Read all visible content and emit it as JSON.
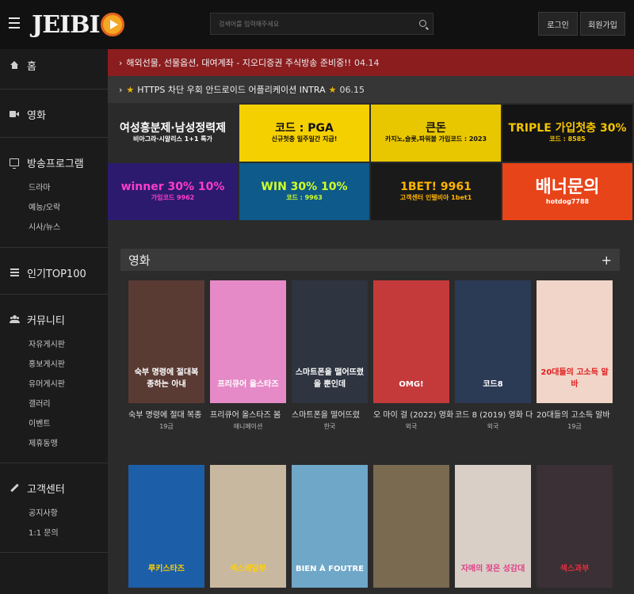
{
  "header": {
    "logo_text": "JEIBI",
    "search_placeholder": "검색어를 입력해주세요",
    "login": "로그인",
    "join": "회원가입"
  },
  "sidebar": {
    "home": "홈",
    "movies": "영화",
    "broadcast": "방송프로그램",
    "broadcast_items": [
      "드라마",
      "예능/오락",
      "시사/뉴스"
    ],
    "top100": "인기TOP100",
    "community": "커뮤니티",
    "community_items": [
      "자유게시판",
      "홍보게시판",
      "유머게시판",
      "갤러리",
      "이벤트",
      "제휴동맹"
    ],
    "support": "고객센터",
    "support_items": [
      "공지사항",
      "1:1 문의"
    ]
  },
  "notices": [
    {
      "text": "해외선물, 선물옵션, 대여계좌 - 지오디증권 주식방송 준비중!!",
      "date": "04.14"
    },
    {
      "text": "HTTPS 차단 우회 안드로이드 어플리케이션 INTRA",
      "date": "06.15"
    }
  ],
  "banners": [
    {
      "big": "여성흥분제·남성정력제",
      "sm": "비아그라·시알리스 1+1 특가",
      "bg": "#2a2a2a",
      "fg": "#ffffff"
    },
    {
      "big": "코드 : PGA",
      "sm": "신규첫충 일주일간 지급!",
      "bg": "#f5d000",
      "fg": "#111111"
    },
    {
      "big": "큰돈",
      "sm": "카지노,슬롯,파워볼 가입코드 : 2023",
      "bg": "#e9c700",
      "fg": "#111111"
    },
    {
      "big": "TRIPLE 가입첫충 30%",
      "sm": "코드 : 8585",
      "bg": "#141414",
      "fg": "#f5c400"
    },
    {
      "big": "winner 30% 10%",
      "sm": "가입코드 9962",
      "bg": "#2c1a6e",
      "fg": "#ff3cc8"
    },
    {
      "big": "WIN 30% 10%",
      "sm": "코드 : 9963",
      "bg": "#0e5a8a",
      "fg": "#d0ff2a"
    },
    {
      "big": "1BET! 9961",
      "sm": "고객센터 인텔비아 1bet1",
      "bg": "#1a1a1a",
      "fg": "#ffb400"
    },
    {
      "big": "배너문의",
      "sm": "hotdog7788",
      "bg": "#e8441a",
      "fg": "#ffffff"
    }
  ],
  "section": {
    "title": "영화",
    "plus": "+"
  },
  "movies": [
    {
      "title": "숙부 명령에 절대 복종",
      "cat": "19금",
      "poster_text": "숙부 명령에 절대복종하는 아내",
      "bg": "#5a3b34",
      "fg": "#ffffff"
    },
    {
      "title": "프리큐어 올스타즈 봄",
      "cat": "애니메이션",
      "poster_text": "프리큐어 올스타즈",
      "bg": "#e58ac7",
      "fg": "#ffffff"
    },
    {
      "title": "스마트폰을 떨어뜨렸",
      "cat": "한국",
      "poster_text": "스마트폰을 떨어뜨렸을 뿐인데",
      "bg": "#2e3440",
      "fg": "#ffffff"
    },
    {
      "title": "오 마이 걸 (2022) 영화",
      "cat": "외국",
      "poster_text": "OMG!",
      "bg": "#c43a3a",
      "fg": "#ffffff"
    },
    {
      "title": "코드 8 (2019) 영화 다",
      "cat": "외국",
      "poster_text": "코드8",
      "bg": "#2b3a55",
      "fg": "#ffffff"
    },
    {
      "title": "20대들의 고소득 알바",
      "cat": "19금",
      "poster_text": "20대들의 고소득 알바",
      "bg": "#f0d5c8",
      "fg": "#e02020"
    },
    {
      "title": "",
      "cat": "",
      "poster_text": "루키스타즈",
      "bg": "#1d5ea8",
      "fg": "#ffd000"
    },
    {
      "title": "",
      "cat": "",
      "poster_text": "섹스배달부",
      "bg": "#c8b8a0",
      "fg": "#ffd000"
    },
    {
      "title": "",
      "cat": "",
      "poster_text": "BIEN À FOUTRE",
      "bg": "#6fa7c8",
      "fg": "#ffffff"
    },
    {
      "title": "",
      "cat": "",
      "poster_text": "",
      "bg": "#7a6a50",
      "fg": "#ffffff"
    },
    {
      "title": "",
      "cat": "",
      "poster_text": "자매의 젖은 성감대",
      "bg": "#d9cfc6",
      "fg": "#e0408a"
    },
    {
      "title": "",
      "cat": "",
      "poster_text": "섹스과부",
      "bg": "#3a3035",
      "fg": "#e03040"
    }
  ]
}
